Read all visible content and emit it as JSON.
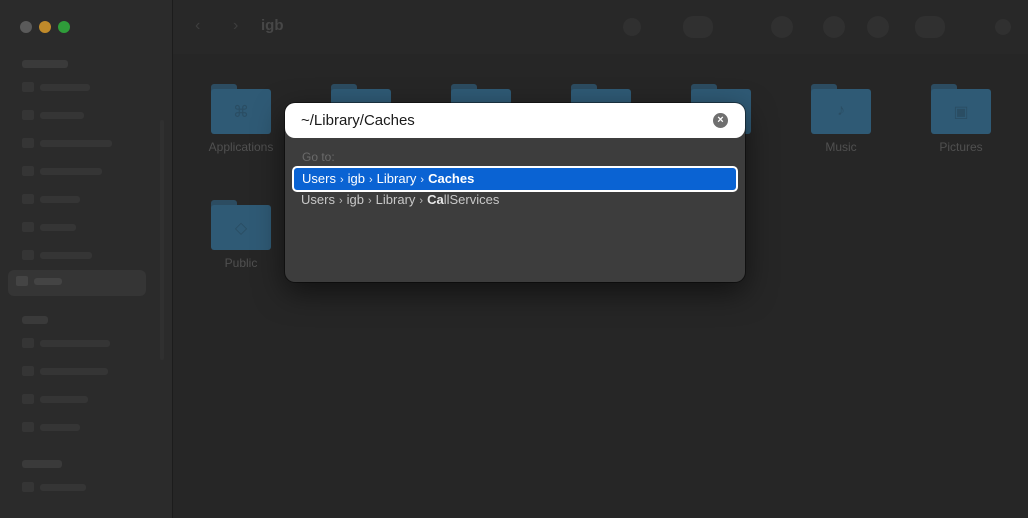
{
  "window": {
    "folder_title": "igb",
    "nav_back": "‹",
    "nav_forward": "›",
    "colors": {
      "background": "#262626",
      "folder": "#2f5a75",
      "dialog": "#3d3d3d",
      "selection": "#0a63d3"
    }
  },
  "files": [
    {
      "label": "Applications",
      "icon": "folder-apps-icon"
    },
    {
      "label": "Music",
      "icon": "folder-music-icon"
    },
    {
      "label": "Pictures",
      "icon": "folder-pictures-icon"
    },
    {
      "label": "Public",
      "icon": "folder-public-icon"
    }
  ],
  "dialog": {
    "path_value": "~/Library/Caches",
    "clear_icon": "×",
    "goto_label": "Go to:",
    "results": [
      {
        "crumbs": [
          "Users",
          "igb",
          "Library"
        ],
        "last": "Caches",
        "selected": true
      },
      {
        "crumbs": [
          "Users",
          "igb",
          "Library"
        ],
        "last_highlight": "Ca",
        "last_rest": "llServices",
        "selected": false
      }
    ],
    "separator": "›"
  }
}
